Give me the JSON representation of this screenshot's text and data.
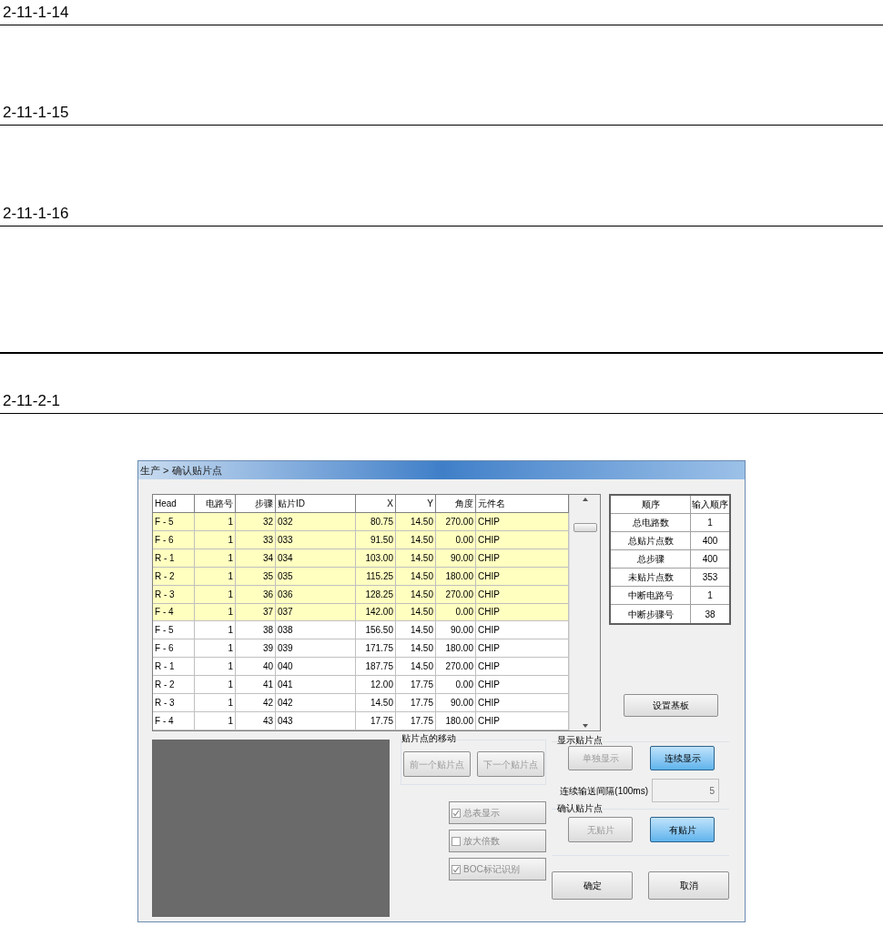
{
  "headings": [
    {
      "text": "2-11-1-14"
    },
    {
      "text": "2-11-1-15"
    },
    {
      "text": "2-11-1-16"
    },
    {
      "text": "2-11-2-1"
    }
  ],
  "window": {
    "title": "生产 > 确认贴片点"
  },
  "table": {
    "columns": [
      "Head",
      "电路号",
      "步骤",
      "贴片ID",
      "X",
      "Y",
      "角度",
      "元件名"
    ],
    "rows": [
      {
        "highlighted": true,
        "cells": [
          "F - 5",
          "1",
          "32",
          "032",
          "80.75",
          "14.50",
          "270.00",
          "CHIP"
        ]
      },
      {
        "highlighted": true,
        "cells": [
          "F - 6",
          "1",
          "33",
          "033",
          "91.50",
          "14.50",
          "0.00",
          "CHIP"
        ]
      },
      {
        "highlighted": true,
        "cells": [
          "R - 1",
          "1",
          "34",
          "034",
          "103.00",
          "14.50",
          "90.00",
          "CHIP"
        ]
      },
      {
        "highlighted": true,
        "cells": [
          "R - 2",
          "1",
          "35",
          "035",
          "115.25",
          "14.50",
          "180.00",
          "CHIP"
        ]
      },
      {
        "highlighted": true,
        "cells": [
          "R - 3",
          "1",
          "36",
          "036",
          "128.25",
          "14.50",
          "270.00",
          "CHIP"
        ]
      },
      {
        "highlighted": true,
        "cells": [
          "F - 4",
          "1",
          "37",
          "037",
          "142.00",
          "14.50",
          "0.00",
          "CHIP"
        ]
      },
      {
        "highlighted": false,
        "cells": [
          "F - 5",
          "1",
          "38",
          "038",
          "156.50",
          "14.50",
          "90.00",
          "CHIP"
        ]
      },
      {
        "highlighted": false,
        "cells": [
          "F - 6",
          "1",
          "39",
          "039",
          "171.75",
          "14.50",
          "180.00",
          "CHIP"
        ]
      },
      {
        "highlighted": false,
        "cells": [
          "R - 1",
          "1",
          "40",
          "040",
          "187.75",
          "14.50",
          "270.00",
          "CHIP"
        ]
      },
      {
        "highlighted": false,
        "cells": [
          "R - 2",
          "1",
          "41",
          "041",
          "12.00",
          "17.75",
          "0.00",
          "CHIP"
        ]
      },
      {
        "highlighted": false,
        "cells": [
          "R - 3",
          "1",
          "42",
          "042",
          "14.50",
          "17.75",
          "90.00",
          "CHIP"
        ]
      },
      {
        "highlighted": false,
        "cells": [
          "F - 4",
          "1",
          "43",
          "043",
          "17.75",
          "17.75",
          "180.00",
          "CHIP"
        ]
      }
    ]
  },
  "info_table": {
    "columns": [
      "顺序",
      "输入顺序"
    ],
    "rows": [
      [
        "总电路数",
        "1"
      ],
      [
        "总贴片点数",
        "400"
      ],
      [
        "总步骤",
        "400"
      ],
      [
        "未贴片点数",
        "353"
      ],
      [
        "中断电路号",
        "1"
      ],
      [
        "中断步骤号",
        "38"
      ]
    ]
  },
  "set_board_button": "设置基板",
  "move_group": {
    "title": "贴片点的移动",
    "buttons": [
      {
        "label": "前一个贴片点",
        "disabled": true
      },
      {
        "label": "下一个贴片点",
        "disabled": true
      }
    ]
  },
  "options": [
    {
      "label": "总表显示",
      "checked": true,
      "disabled": true
    },
    {
      "label": "放大倍数",
      "checked": false,
      "disabled": true
    },
    {
      "label": "BOC标记识别",
      "checked": true,
      "disabled": true
    }
  ],
  "display_group": {
    "title": "显示贴片点",
    "buttons": [
      {
        "label": "单独显示",
        "selected": false
      },
      {
        "label": "连续显示",
        "selected": true
      }
    ],
    "interval_label": "连续输送间隔(100ms)",
    "interval_value": "5"
  },
  "confirm_group": {
    "title": "确认贴片点",
    "buttons": [
      {
        "label": "无贴片",
        "selected": false
      },
      {
        "label": "有贴片",
        "selected": true
      }
    ]
  },
  "footer_buttons": [
    "确定",
    "取消"
  ]
}
